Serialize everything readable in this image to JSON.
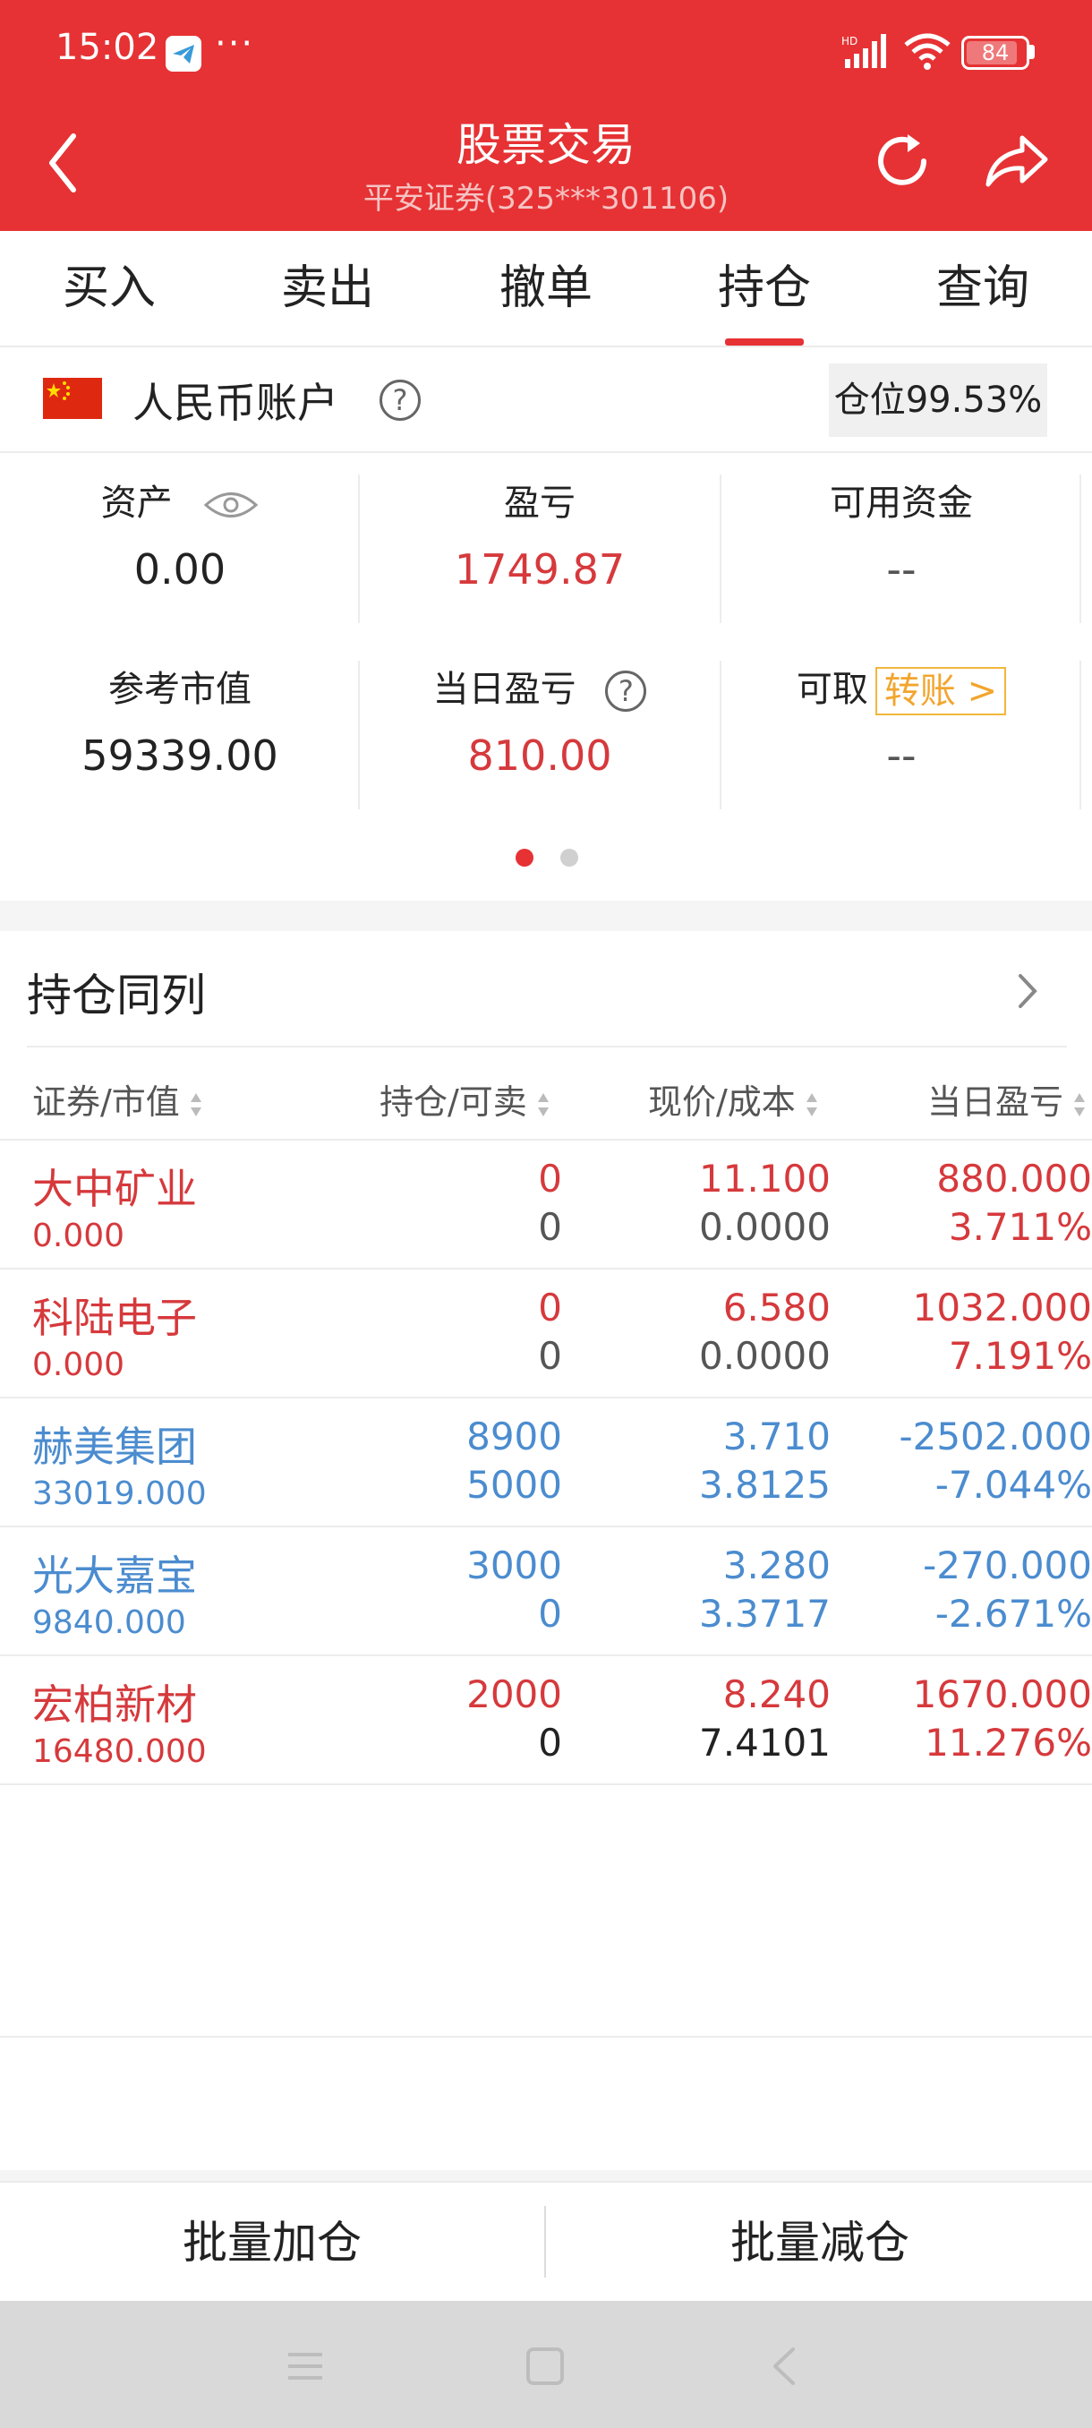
{
  "status_bar": {
    "time": "15:02",
    "dots": "···",
    "battery": "84",
    "icons": [
      "telegram-icon",
      "hd-signal-icon",
      "wifi-icon",
      "battery-icon"
    ]
  },
  "header": {
    "title": "股票交易",
    "subtitle": "平安证券(325***301106)",
    "icons": [
      "back-icon",
      "refresh-icon",
      "share-icon"
    ]
  },
  "tabs": [
    {
      "label": "买入",
      "active": false
    },
    {
      "label": "卖出",
      "active": false
    },
    {
      "label": "撤单",
      "active": false
    },
    {
      "label": "持仓",
      "active": true
    },
    {
      "label": "查询",
      "active": false
    }
  ],
  "account": {
    "label": "人民币账户",
    "help": "?",
    "position": "仓位99.53%"
  },
  "summary": {
    "assets_label": "资产",
    "assets_value": "0.00",
    "pnl_label": "盈亏",
    "pnl_value": "1749.87",
    "available_label": "可用资金",
    "available_value": "--",
    "market_label": "参考市值",
    "market_value": "59339.00",
    "daily_label": "当日盈亏",
    "daily_help": "?",
    "daily_value": "810.00",
    "withdraw_label": "可取",
    "transfer_label": "转账 >",
    "withdraw_value": "--",
    "page_indicator": {
      "current": 1,
      "total": 2
    }
  },
  "holdings": {
    "title": "持仓同列",
    "columns": [
      "证券/市值",
      "持仓/可卖",
      "现价/成本",
      "当日盈亏"
    ],
    "rows": [
      {
        "name": "大中矿业",
        "market_value": "0.000",
        "hold": "0",
        "sellable": "0",
        "price": "11.100",
        "cost": "0.0000",
        "daily_pnl": "880.000",
        "daily_pct": "3.711%",
        "color": "#d6393c"
      },
      {
        "name": "科陆电子",
        "market_value": "0.000",
        "hold": "0",
        "sellable": "0",
        "price": "6.580",
        "cost": "0.0000",
        "daily_pnl": "1032.000",
        "daily_pct": "7.191%",
        "color": "#d6393c"
      },
      {
        "name": "赫美集团",
        "market_value": "33019.000",
        "hold": "8900",
        "sellable": "5000",
        "price": "3.710",
        "cost": "3.8125",
        "daily_pnl": "-2502.000",
        "daily_pct": "-7.044%",
        "color": "#4b8ccf"
      },
      {
        "name": "光大嘉宝",
        "market_value": "9840.000",
        "hold": "3000",
        "sellable": "0",
        "price": "3.280",
        "cost": "3.3717",
        "daily_pnl": "-270.000",
        "daily_pct": "-2.671%",
        "color": "#4b8ccf"
      },
      {
        "name": "宏柏新材",
        "market_value": "16480.000",
        "hold": "2000",
        "sellable": "0",
        "price": "8.240",
        "cost": "7.4101",
        "daily_pnl": "1670.000",
        "daily_pct": "11.276%",
        "color": "#d6393c"
      }
    ]
  },
  "bottom_actions": {
    "batch_add": "批量加仓",
    "batch_reduce": "批量减仓"
  },
  "colors": {
    "brand_red": "#e63234",
    "profit": "#d6393c",
    "loss": "#4b8ccf",
    "transfer": "#f2a52e"
  }
}
